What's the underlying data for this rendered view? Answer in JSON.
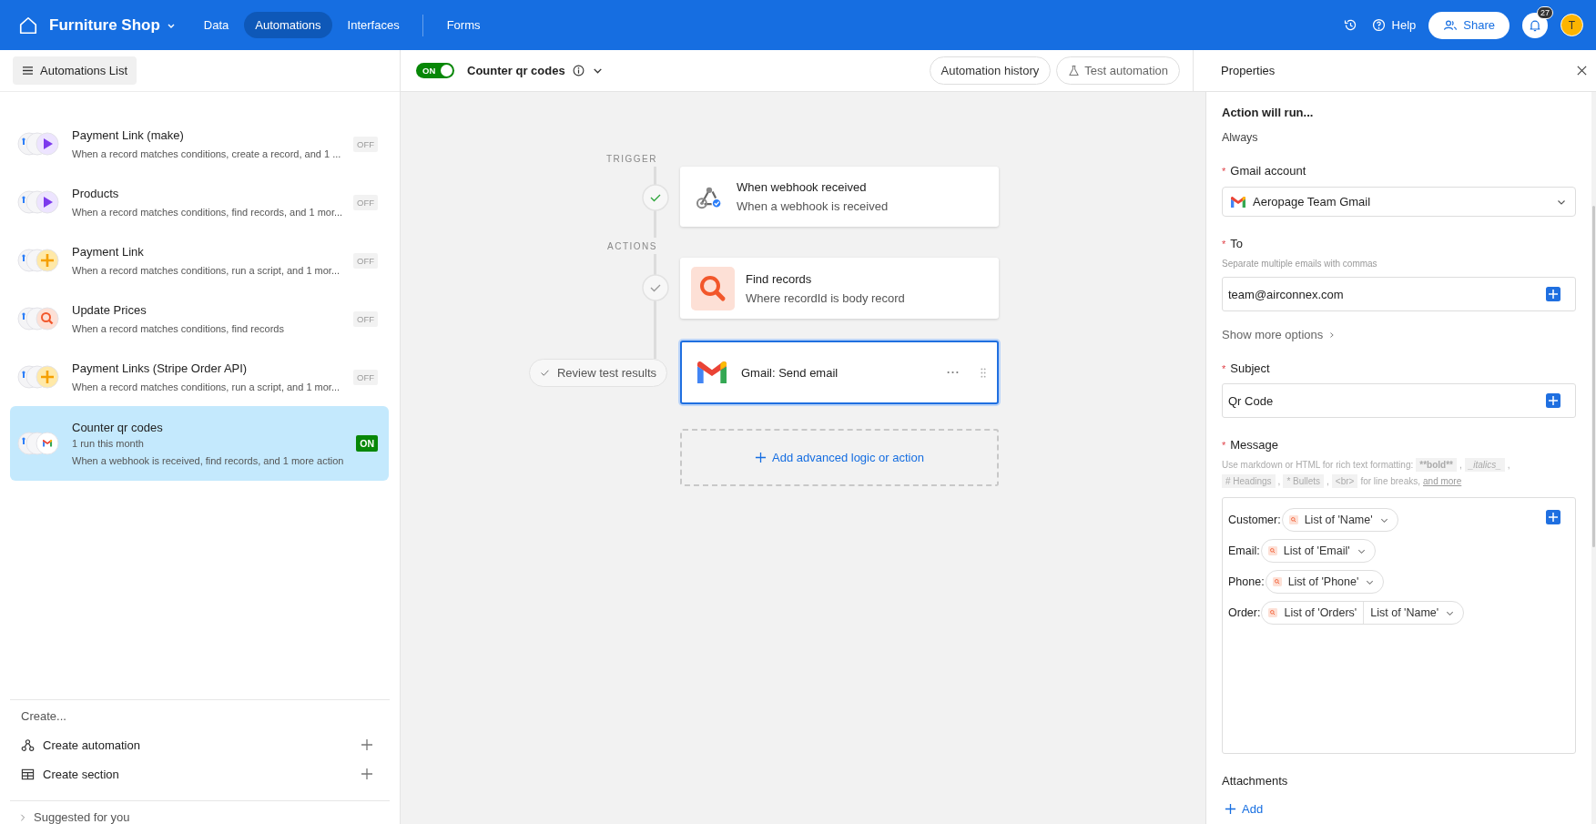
{
  "topbar": {
    "app_name": "Furniture Shop",
    "nav": [
      {
        "label": "Data",
        "selected": false
      },
      {
        "label": "Automations",
        "selected": true
      },
      {
        "label": "Interfaces",
        "selected": false
      },
      {
        "label": "Forms",
        "selected": false
      }
    ],
    "help": "Help",
    "share": "Share",
    "notification_count": "27",
    "avatar": "T"
  },
  "sidebar": {
    "list_button": "Automations List",
    "automations": [
      {
        "name": "Payment Link (make)",
        "kind": "run",
        "description": "When a record matches conditions, create a record, and 1 ...",
        "status": "OFF",
        "on": false,
        "selected": false
      },
      {
        "name": "Products",
        "kind": "run",
        "description": "When a record matches conditions, find records, and 1 mor...",
        "status": "OFF",
        "on": false,
        "selected": false
      },
      {
        "name": "Payment Link",
        "kind": "script",
        "description": "When a record matches conditions, run a script, and 1 mor...",
        "status": "OFF",
        "on": false,
        "selected": false
      },
      {
        "name": "Update Prices",
        "kind": "find",
        "description": "When a record matches conditions, find records",
        "status": "OFF",
        "on": false,
        "selected": false
      },
      {
        "name": "Payment Links (Stripe Order API)",
        "kind": "script",
        "description": "When a record matches conditions, run a script, and 1 mor...",
        "status": "OFF",
        "on": false,
        "selected": false
      },
      {
        "name": "Counter qr codes",
        "kind": "gmail",
        "runs": "1 run this month",
        "description": "When a webhook is received, find records, and 1 more action",
        "status": "ON",
        "on": true,
        "selected": true
      }
    ],
    "create_heading": "Create...",
    "create_items": [
      {
        "kind": "automation",
        "label": "Create automation"
      },
      {
        "kind": "section",
        "label": "Create section"
      }
    ],
    "suggested": "Suggested for you"
  },
  "editor": {
    "toggle": {
      "label": "ON",
      "on": true
    },
    "title": "Counter qr codes",
    "buttons": [
      "Automation history",
      "Test automation"
    ],
    "trigger_label": "TRIGGER",
    "actions_label": "ACTIONS",
    "steps": [
      {
        "kind": "webhook",
        "title": "When webhook received",
        "subtitle": "When a webhook is received",
        "passed": true,
        "selected": false
      },
      {
        "kind": "find",
        "title": "Find records",
        "subtitle": "Where recordId is body record",
        "passed": false,
        "selected": false
      },
      {
        "kind": "gmail",
        "title": "Gmail: Send email",
        "review": "Review test results",
        "selected": true
      }
    ],
    "add_action": "Add advanced logic or action"
  },
  "properties": {
    "title": "Properties",
    "run_label": "Action will run...",
    "run_value": "Always",
    "account": {
      "mark": "*",
      "label": "Gmail account",
      "value": "Aeropage Team Gmail"
    },
    "to": {
      "mark": "*",
      "label": "To",
      "hint": "Separate multiple emails with commas",
      "value": "team@airconnex.com"
    },
    "more_options": "Show more options",
    "subject": {
      "mark": "*",
      "label": "Subject",
      "value": "Qr Code"
    },
    "message": {
      "mark": "*",
      "label": "Message",
      "hint": [
        {
          "kind": "text",
          "text": "Use markdown or HTML for rich text formatting:"
        },
        {
          "kind": "boldcode",
          "text": "**bold**"
        },
        {
          "kind": "text",
          "text": ","
        },
        {
          "kind": "italiccode",
          "text": "_italics_"
        },
        {
          "kind": "text",
          "text": ","
        },
        {
          "kind": "code",
          "text": "# Headings"
        },
        {
          "kind": "text",
          "text": ","
        },
        {
          "kind": "code",
          "text": "* Bullets"
        },
        {
          "kind": "text",
          "text": ","
        },
        {
          "kind": "code",
          "text": "<br>"
        },
        {
          "kind": "text",
          "text": "for line breaks,"
        },
        {
          "kind": "link",
          "text": "and more"
        }
      ],
      "lines": [
        {
          "label": "Customer:",
          "segments": [
            "List of 'Name'"
          ]
        },
        {
          "label": "Email:",
          "segments": [
            "List of 'Email'"
          ]
        },
        {
          "label": "Phone:",
          "segments": [
            "List of 'Phone'"
          ]
        },
        {
          "label": "Order:",
          "segments": [
            "List of 'Orders'",
            "List of 'Name'"
          ]
        }
      ]
    },
    "attachments": {
      "label": "Attachments",
      "add": "Add"
    }
  }
}
